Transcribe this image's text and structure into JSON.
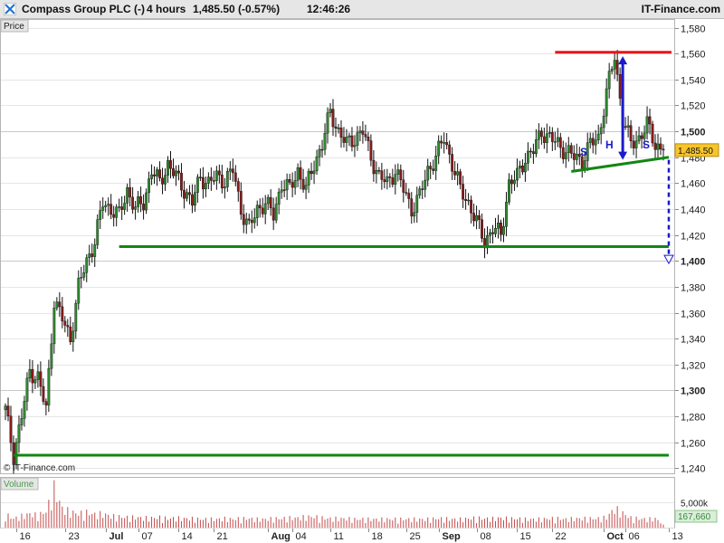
{
  "header": {
    "instrument": "Compass Group PLC (-)",
    "timeframe": "4 hours",
    "quote": "1,485.50 (-0.57%)",
    "time": "12:46:26",
    "brand": "IT-Finance.com"
  },
  "panels": {
    "price_label": "Price",
    "volume_label": "Volume",
    "copyright": "© IT-Finance.com",
    "last_price_tag": "1,485.50",
    "last_volume_tag": "167,660"
  },
  "pattern_labels": {
    "left_shoulder": "S",
    "head": "H",
    "right_shoulder": "S"
  },
  "colors": {
    "up_candle": "#2e8b2e",
    "down_candle": "#8b1a1a",
    "resistance": "#e8141b",
    "support": "#138613",
    "pattern_annotation": "#1a1acd",
    "last_price_tag": "#f7c52b"
  },
  "chart_data": {
    "type": "candlestick",
    "y_axis": {
      "range": [
        1236,
        1586
      ],
      "ticks": [
        "1,580",
        "1,560",
        "1,540",
        "1,520",
        "1,500",
        "1,480",
        "1,460",
        "1,440",
        "1,420",
        "1,400",
        "1,380",
        "1,360",
        "1,340",
        "1,320",
        "1,300",
        "1,280",
        "1,260",
        "1,240"
      ],
      "tick_values": [
        1580,
        1560,
        1540,
        1520,
        1500,
        1480,
        1460,
        1440,
        1420,
        1400,
        1380,
        1360,
        1340,
        1320,
        1300,
        1280,
        1260,
        1240
      ],
      "bold_ticks": [
        "1,500",
        "1,400",
        "1,300"
      ]
    },
    "x_axis": {
      "range": [
        0,
        243
      ],
      "ticks": [
        {
          "label": "16",
          "bar": 4,
          "bold": false
        },
        {
          "label": "23",
          "bar": 22,
          "bold": false
        },
        {
          "label": "Jul",
          "bar": 37,
          "bold": true
        },
        {
          "label": "07",
          "bar": 49,
          "bold": false
        },
        {
          "label": "14",
          "bar": 64,
          "bold": false
        },
        {
          "label": "21",
          "bar": 77,
          "bold": false
        },
        {
          "label": "Aug",
          "bar": 97,
          "bold": true
        },
        {
          "label": "04",
          "bar": 106,
          "bold": false
        },
        {
          "label": "11",
          "bar": 120,
          "bold": false
        },
        {
          "label": "18",
          "bar": 134,
          "bold": false
        },
        {
          "label": "25",
          "bar": 148,
          "bold": false
        },
        {
          "label": "Sep",
          "bar": 160,
          "bold": true
        },
        {
          "label": "08",
          "bar": 174,
          "bold": false
        },
        {
          "label": "15",
          "bar": 189,
          "bold": false
        },
        {
          "label": "22",
          "bar": 202,
          "bold": false
        },
        {
          "label": "Oct",
          "bar": 221,
          "bold": true
        },
        {
          "label": "06",
          "bar": 229,
          "bold": false
        },
        {
          "label": "13",
          "bar": 245,
          "bold": false
        }
      ]
    },
    "volume_axis": {
      "ticks": [
        "5,000k"
      ],
      "tick_values": [
        5000
      ],
      "max": 7500,
      "unit": "thousand shares"
    },
    "trend_lines": [
      {
        "name": "resistance",
        "x": [
          203,
          246
        ],
        "y": [
          1561,
          1561
        ]
      },
      {
        "name": "neckline",
        "x": [
          209,
          245
        ],
        "y": [
          1469,
          1480
        ]
      },
      {
        "name": "support",
        "x": [
          42,
          245
        ],
        "y": [
          1411,
          1411
        ]
      },
      {
        "name": "lower support",
        "x": [
          3,
          245
        ],
        "y": [
          1250,
          1250
        ]
      }
    ],
    "arrows": [
      {
        "name": "head height",
        "x": [
          228,
          228
        ],
        "y": [
          1558,
          1478
        ]
      },
      {
        "name": "projected target",
        "x": [
          245,
          245
        ],
        "y": [
          1478,
          1398
        ]
      }
    ],
    "price_anchors": {
      "bar": [
        0,
        3,
        6,
        9,
        12,
        15,
        18,
        21,
        24,
        27,
        30,
        33,
        36,
        39,
        42,
        45,
        48,
        51,
        54,
        57,
        60,
        63,
        66,
        69,
        72,
        75,
        78,
        81,
        84,
        87,
        90,
        93,
        96,
        99,
        102,
        105,
        108,
        111,
        114,
        117,
        120,
        123,
        126,
        129,
        132,
        135,
        138,
        141,
        144,
        147,
        150,
        153,
        156,
        159,
        162,
        165,
        168,
        171,
        174,
        177,
        180,
        183,
        186,
        189,
        192,
        195,
        198,
        201,
        204,
        207,
        210,
        213,
        216,
        219,
        222,
        225,
        228,
        231,
        234,
        237,
        240,
        243
      ],
      "close": [
        1285,
        1250,
        1280,
        1315,
        1310,
        1285,
        1370,
        1355,
        1340,
        1380,
        1400,
        1415,
        1445,
        1440,
        1435,
        1455,
        1440,
        1445,
        1470,
        1460,
        1475,
        1465,
        1455,
        1445,
        1465,
        1460,
        1465,
        1462,
        1470,
        1440,
        1425,
        1440,
        1445,
        1435,
        1460,
        1455,
        1470,
        1455,
        1475,
        1490,
        1515,
        1500,
        1490,
        1495,
        1500,
        1480,
        1465,
        1460,
        1470,
        1455,
        1440,
        1450,
        1470,
        1480,
        1495,
        1475,
        1455,
        1445,
        1430,
        1415,
        1425,
        1420,
        1460,
        1465,
        1480,
        1485,
        1500,
        1495,
        1490,
        1485,
        1480,
        1478,
        1490,
        1495,
        1530,
        1558,
        1510,
        1490,
        1495,
        1505,
        1490,
        1485.5
      ]
    },
    "volume_anchors": {
      "bar": [
        0,
        3,
        6,
        9,
        12,
        15,
        18,
        21,
        24,
        27,
        30,
        33,
        36,
        39,
        42,
        45,
        48,
        51,
        54,
        57,
        60,
        63,
        66,
        69,
        72,
        75,
        78,
        81,
        84,
        87,
        90,
        93,
        96,
        99,
        102,
        105,
        108,
        111,
        114,
        117,
        120,
        123,
        126,
        129,
        132,
        135,
        138,
        141,
        144,
        147,
        150,
        153,
        156,
        159,
        162,
        165,
        168,
        171,
        174,
        177,
        180,
        183,
        186,
        189,
        192,
        195,
        198,
        201,
        204,
        207,
        210,
        213,
        216,
        219,
        222,
        225,
        228,
        231,
        234,
        237,
        240,
        243
      ],
      "volume_k": [
        2200,
        1500,
        1900,
        2300,
        2000,
        2700,
        6500,
        3200,
        2600,
        2300,
        2500,
        2200,
        2300,
        1900,
        1800,
        1700,
        1700,
        1600,
        1600,
        1700,
        1500,
        1600,
        1500,
        1500,
        1400,
        1400,
        1400,
        1500,
        1400,
        1500,
        1500,
        1400,
        1400,
        1500,
        1500,
        1600,
        1600,
        1800,
        1800,
        1600,
        1500,
        1500,
        1500,
        1400,
        1400,
        1400,
        1400,
        1400,
        1400,
        1400,
        1400,
        1400,
        1400,
        1500,
        1500,
        1400,
        1400,
        1500,
        1600,
        1500,
        1500,
        1600,
        1500,
        1500,
        1400,
        1400,
        1400,
        1500,
        1500,
        1400,
        1500,
        1500,
        1500,
        1500,
        1700,
        3200,
        2400,
        1600,
        1500,
        1400,
        1500,
        600
      ]
    }
  }
}
